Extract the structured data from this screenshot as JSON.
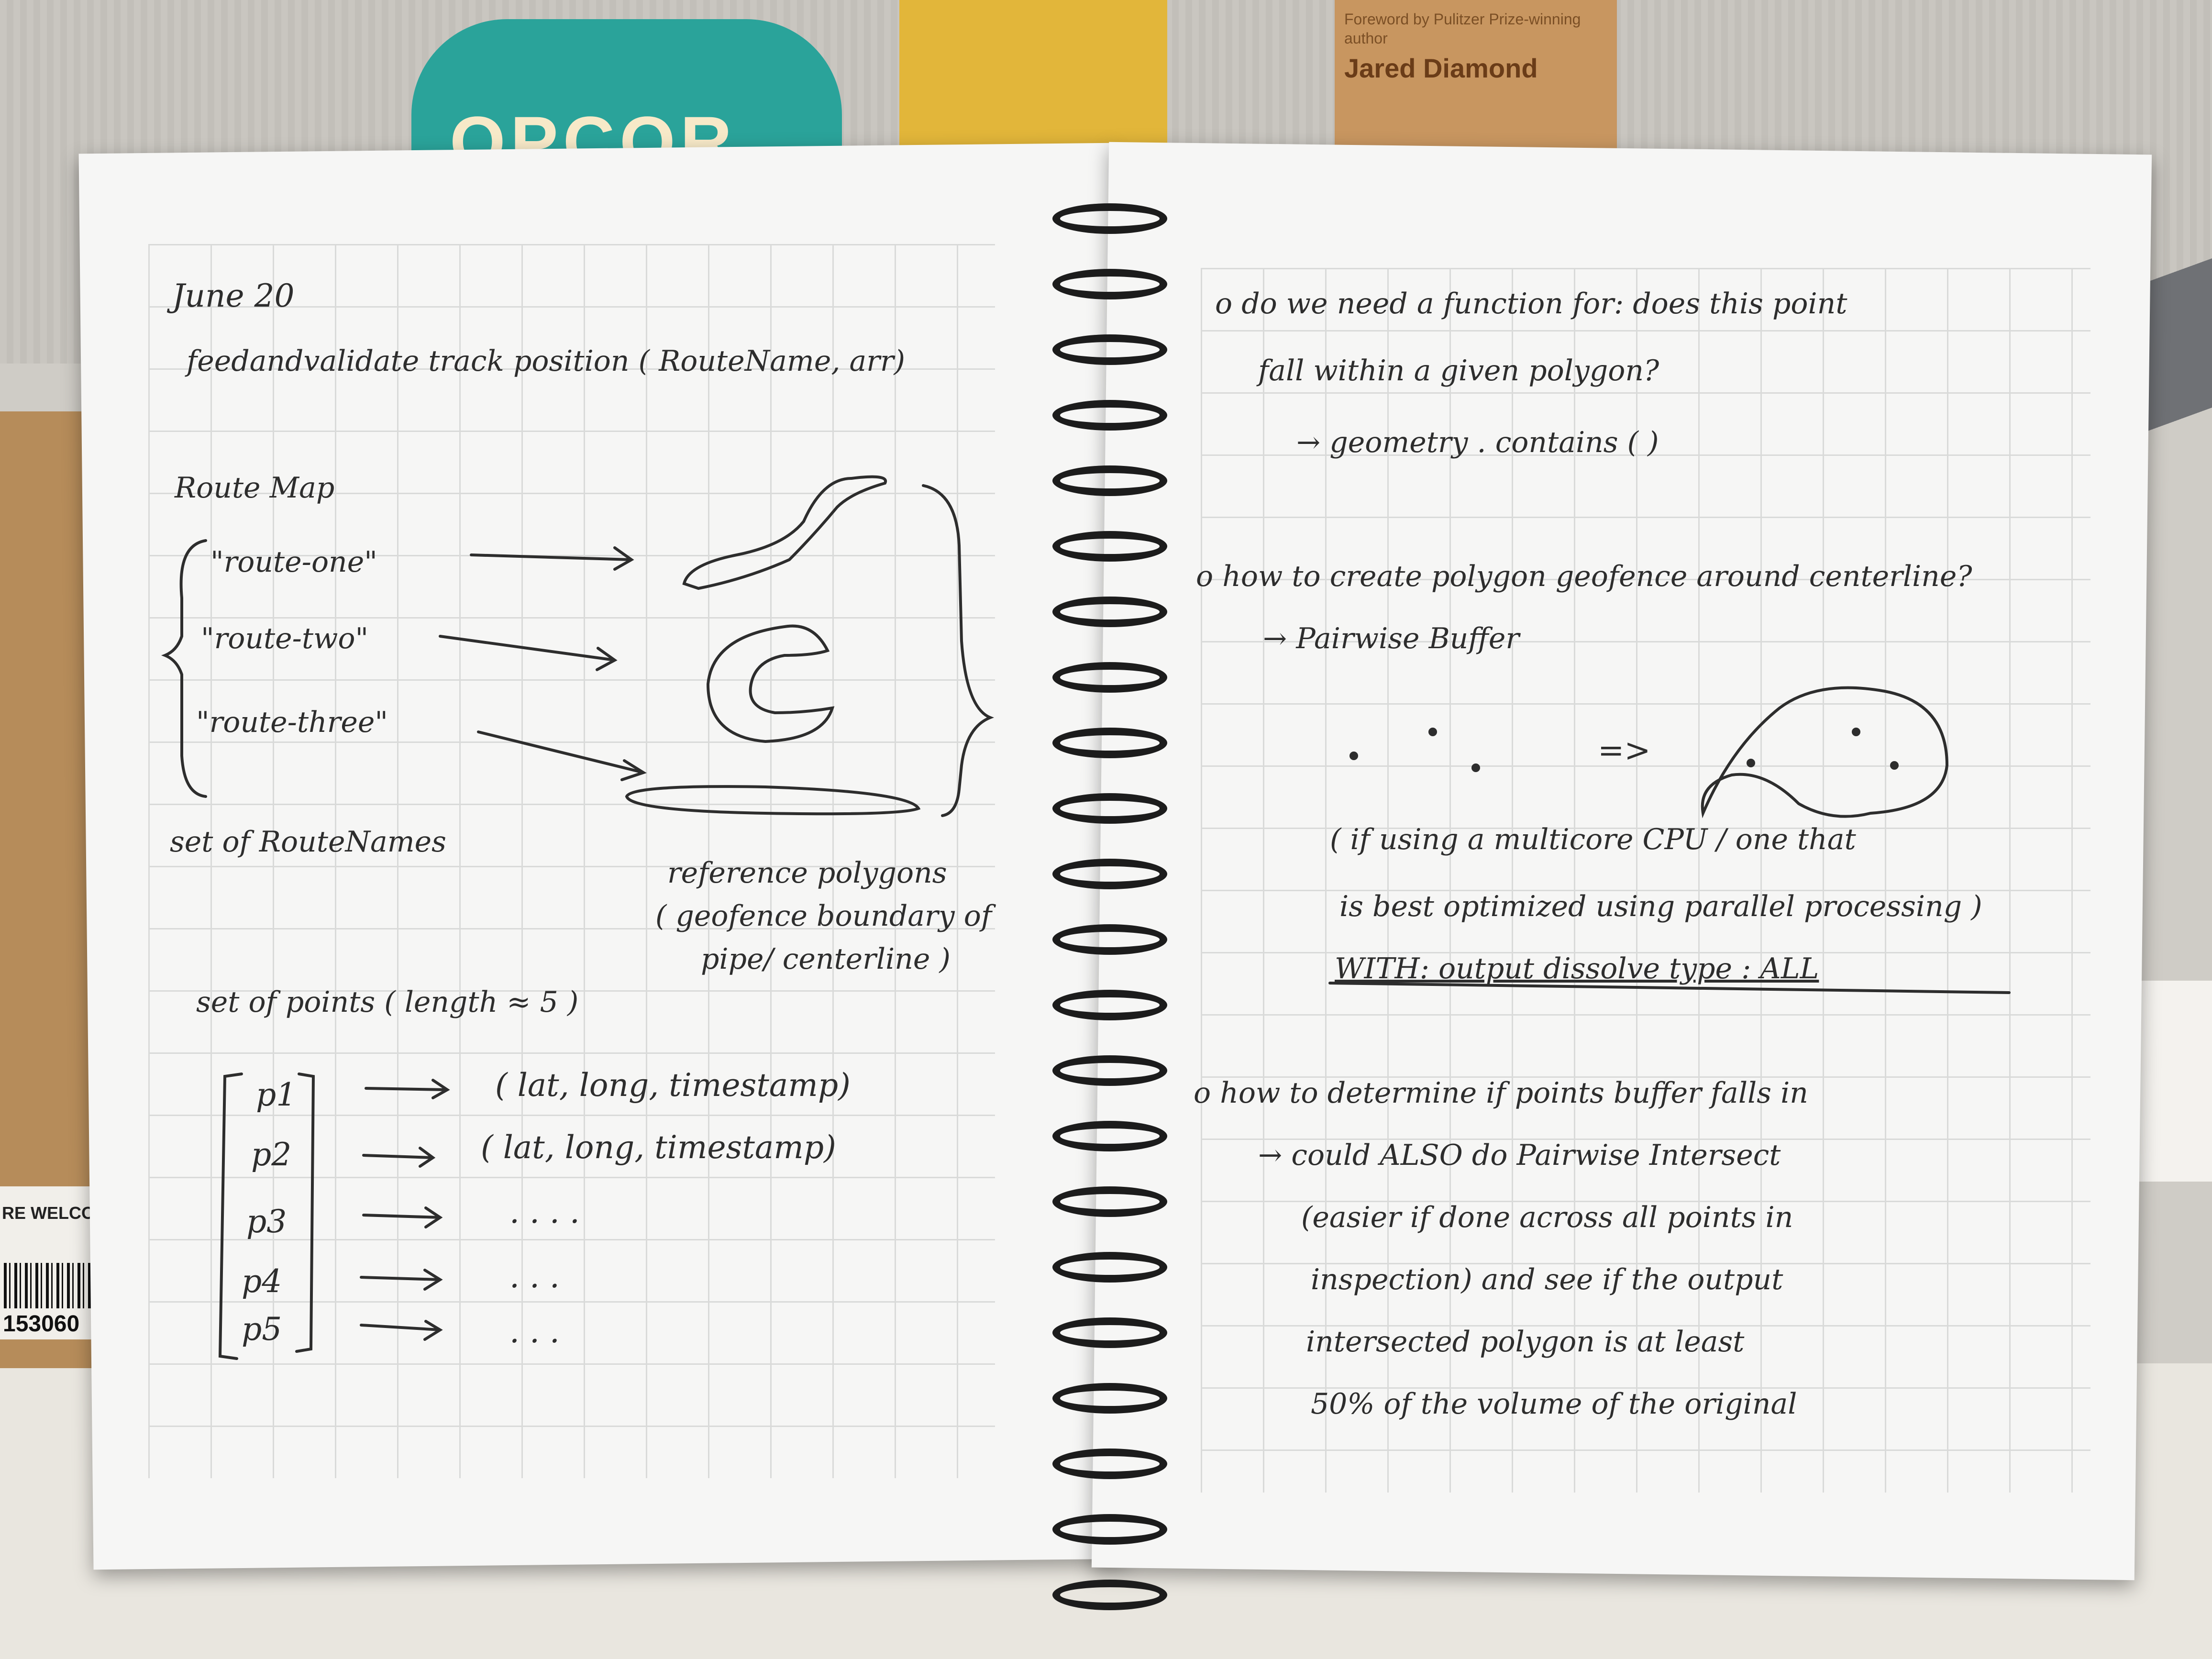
{
  "background": {
    "box_label": "RE WELCOM",
    "box_number": "153060",
    "popcorn_text": "OPCOR",
    "book_blurb": "Foreword by Pulitzer Prize-winning author",
    "book_author": "Jared Diamond"
  },
  "left_page": {
    "date": "June 20",
    "function_call": "feedandvalidate track position ( RouteName, arr)",
    "route_map_label": "Route Map",
    "routes": [
      "\"route-one\"",
      "\"route-two\"",
      "\"route-three\""
    ],
    "set_of_routenames": "set of RouteNames",
    "reference_polygons": [
      "reference polygons",
      "( geofence boundary of",
      "pipe/ centerline )"
    ],
    "set_of_points": "set of points ( length ≈ 5 )",
    "points": [
      {
        "label": "p1",
        "value": "( lat, long, timestamp)"
      },
      {
        "label": "p2",
        "value": "( lat, long, timestamp)"
      },
      {
        "label": "p3",
        "value": ". . . ."
      },
      {
        "label": "p4",
        "value": ". . ."
      },
      {
        "label": "p5",
        "value": ". . ."
      }
    ]
  },
  "right_page": {
    "q1": "o  do we need a function for: does this point",
    "q1_cont": "fall  within  a  given  polygon?",
    "q1_answer": "→  geometry . contains ( )",
    "q2": "o how to create polygon geofence around centerline?",
    "q2_answer": "→  Pairwise  Buffer",
    "buffer_arrow": "=>",
    "note1": "( if  using  a  multicore  CPU /  one  that",
    "note2": "is   best   optimized  using   parallel  processing )",
    "note3": "WITH:   output  dissolve  type :  ALL",
    "q3": "o how  to  determine  if  points  buffer  falls  in",
    "q3_answer": "→ could  ALSO  do   Pairwise  Intersect",
    "q3_note1": "(easier  if   done  across  all  points  in",
    "q3_note2": "inspection)  and  see  if   the   output",
    "q3_note3": "intersected  polygon   is   at    least",
    "q3_note4": "50%   of   the  volume  of   the  original"
  }
}
